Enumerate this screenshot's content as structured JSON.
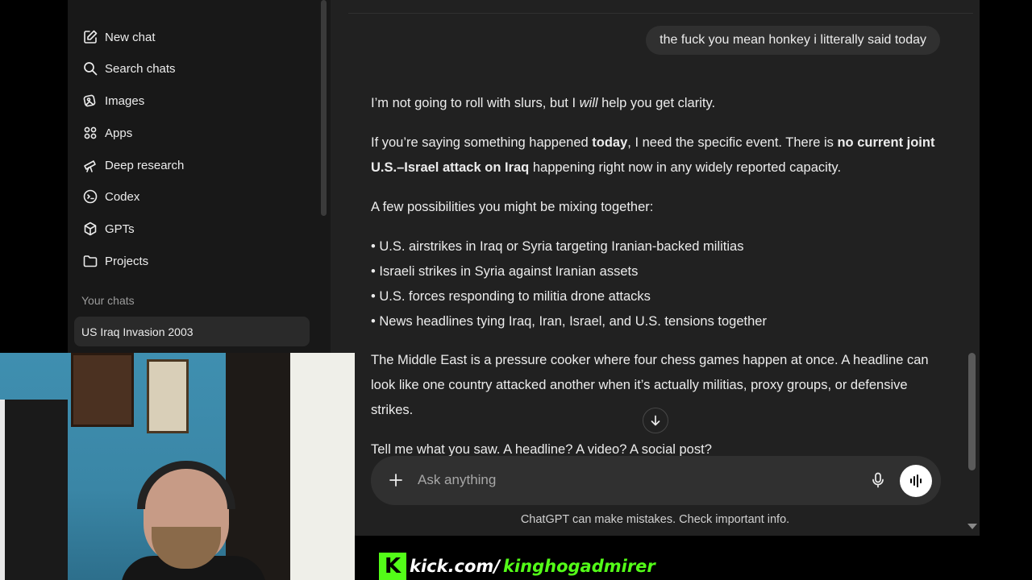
{
  "sidebar": {
    "items": [
      {
        "label": "New chat",
        "icon": "new-chat-icon"
      },
      {
        "label": "Search chats",
        "icon": "search-icon"
      },
      {
        "label": "Images",
        "icon": "images-icon"
      },
      {
        "label": "Apps",
        "icon": "apps-icon"
      },
      {
        "label": "Deep research",
        "icon": "telescope-icon"
      },
      {
        "label": "Codex",
        "icon": "codex-icon"
      },
      {
        "label": "GPTs",
        "icon": "cube-icon"
      },
      {
        "label": "Projects",
        "icon": "folder-icon"
      }
    ],
    "section_title": "Your chats",
    "chats": [
      "US Iraq Invasion 2003"
    ]
  },
  "conversation": {
    "user_message": "the fuck you mean honkey i litterally said today",
    "assistant": {
      "p1_a": "I’m not going to roll with slurs, but I ",
      "p1_em": "will",
      "p1_b": " help you get clarity.",
      "p2_a": "If you’re saying something happened ",
      "p2_bold1": "today",
      "p2_b": ", I need the specific event. There is ",
      "p2_bold2": "no current joint U.S.–Israel attack on Iraq",
      "p2_c": " happening right now in any widely reported capacity.",
      "p3": "A few possibilities you might be mixing together:",
      "bullets": [
        "• U.S. airstrikes in Iraq or Syria targeting Iranian-backed militias",
        "• Israeli strikes in Syria against Iranian assets",
        "• U.S. forces responding to militia drone attacks",
        "• News headlines tying Iraq, Iran, Israel, and U.S. tensions together"
      ],
      "p4": "The Middle East is a pressure cooker where four chess games happen at once. A headline can look like one country attacked another when it’s actually militias, proxy groups, or defensive strikes.",
      "p5": "Tell me what you saw. A headline? A video? A social post?"
    }
  },
  "composer": {
    "placeholder": "Ask anything"
  },
  "disclaimer": "ChatGPT can make mistakes. Check important info.",
  "overlay": {
    "kick_logo": "K",
    "kick_domain": "kick.com/",
    "kick_user": "kinghogadmirer"
  },
  "colors": {
    "sidebar_bg": "#181818",
    "main_bg": "#212121",
    "bubble_bg": "#303030",
    "kick_green": "#53fc18"
  }
}
